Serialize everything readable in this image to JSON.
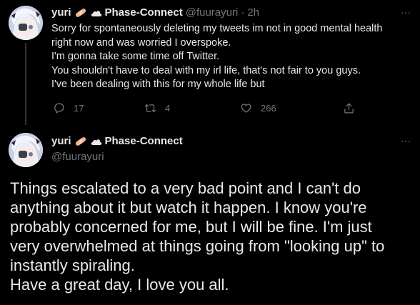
{
  "tweet1": {
    "display_name": "yuri",
    "display_name_suffix": "Phase-Connect",
    "handle": "@fuurayuri",
    "separator": "·",
    "time": "2h",
    "lines": [
      "Sorry for spontaneously deleting my tweets im not in good mental health",
      "right now and was worried I overspoke.",
      "I'm gonna take some time off Twitter.",
      "You shouldn't have to deal with my irl life, that's not fair to you guys.",
      "I've been dealing with this for my whole life but"
    ],
    "actions": {
      "replies": "17",
      "retweets": "4",
      "likes": "266"
    },
    "more": "···"
  },
  "tweet2": {
    "display_name": "yuri",
    "display_name_suffix": "Phase-Connect",
    "handle": "@fuurayuri",
    "more": "···",
    "lines": [
      "Things escalated to a very bad point and I can't do",
      "anything about it but watch it happen. I know you're",
      "probably concerned for me, but I will be fine. I'm just",
      "very overwhelmed at things going from \"looking up\" to",
      "instantly spiraling.",
      "Have a great day, I love you all."
    ]
  },
  "icons": [
    "avatar-image",
    "bandage-emoji-icon",
    "cloud-emoji-icon",
    "reply-icon",
    "retweet-icon",
    "like-icon",
    "share-icon",
    "more-icon"
  ],
  "colors": {
    "background": "#000000",
    "text": "#e7e9ea",
    "secondary": "#71767b",
    "thread_line": "#333639"
  }
}
